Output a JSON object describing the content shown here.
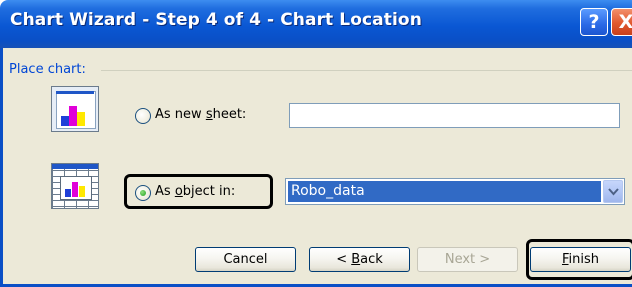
{
  "window": {
    "title": "Chart Wizard - Step 4 of 4 - Chart Location",
    "help_label": "?",
    "close_label": "X"
  },
  "group": {
    "label": "Place chart:"
  },
  "options": {
    "new_sheet": {
      "label_pre": "As new ",
      "label_key": "s",
      "label_post": "heet:",
      "selected": false,
      "value": ""
    },
    "object_in": {
      "label_pre": "As ",
      "label_key": "o",
      "label_post": "bject in:",
      "selected": true,
      "value": "Robo_data"
    }
  },
  "buttons": {
    "cancel": "Cancel",
    "back_pre": "< ",
    "back_key": "B",
    "back_post": "ack",
    "next": "Next >",
    "finish_key": "F",
    "finish_post": "inish"
  },
  "icons": {
    "help": "help-icon",
    "close": "close-icon",
    "new_sheet": "chart-sheet-icon",
    "object_in": "embedded-chart-icon",
    "dropdown": "chevron-down-icon"
  },
  "colors": {
    "titlebar": "#0a57d3",
    "dialog_bg": "#ece9d8",
    "group_label": "#0046d5",
    "selection": "#316ac5",
    "close_button": "#e1582e"
  }
}
